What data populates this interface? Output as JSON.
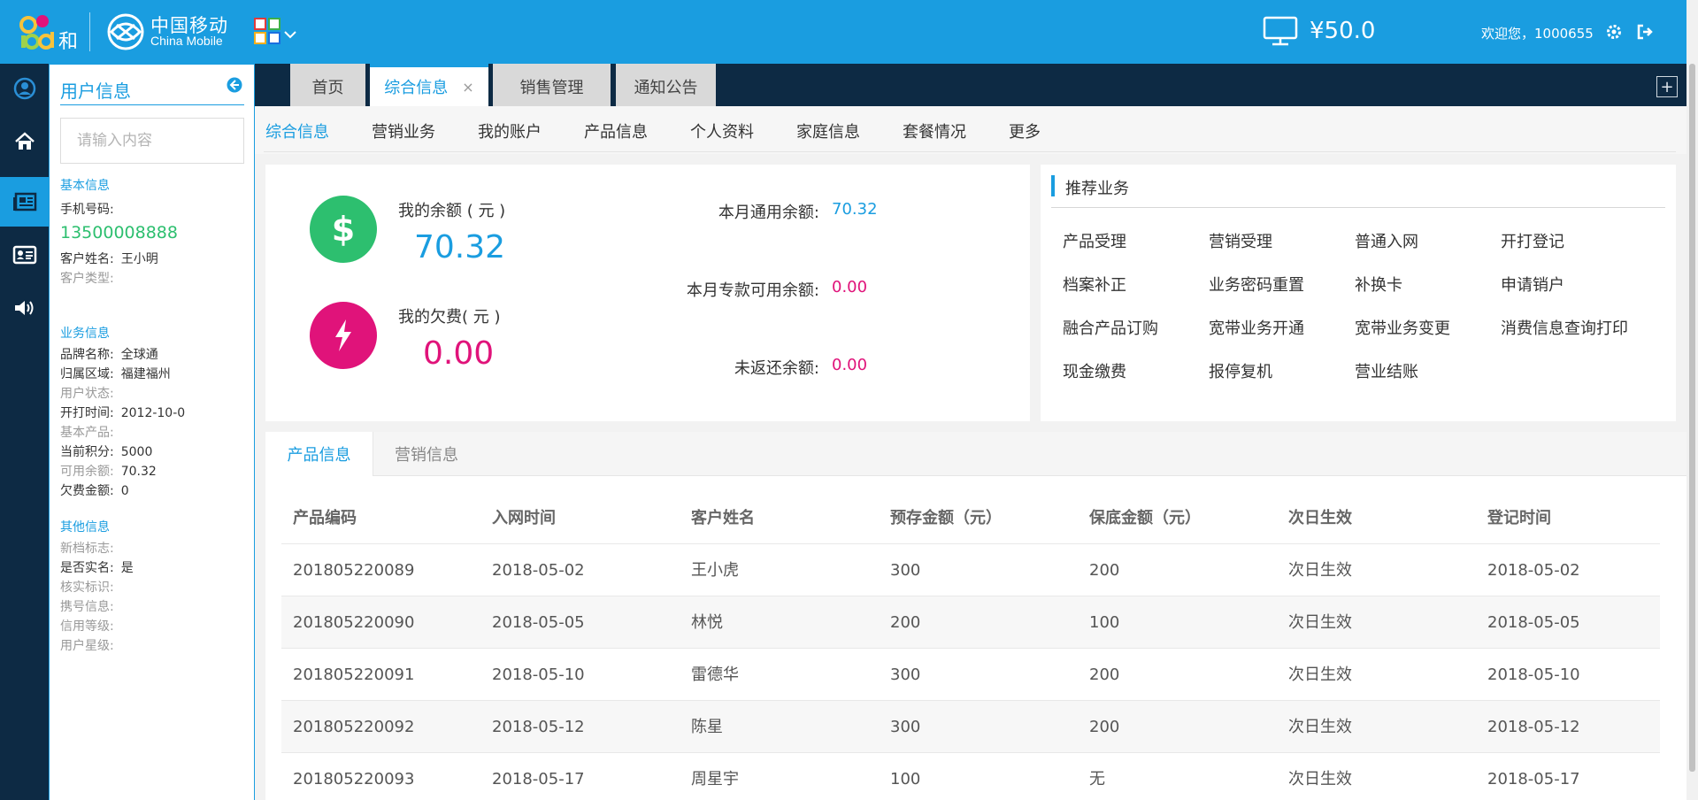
{
  "header": {
    "brand_cn": "中国移动",
    "brand_en": "China Mobile",
    "balance": "¥50.0",
    "welcome": "欢迎您，1000655"
  },
  "tabs": [
    {
      "label": "首页"
    },
    {
      "label": "综合信息",
      "close": "×"
    },
    {
      "label": "销售管理"
    },
    {
      "label": "通知公告"
    }
  ],
  "tab_add": "+",
  "user_panel": {
    "title": "用户信息",
    "search_placeholder": "请输入内容",
    "basic_title": "基本信息",
    "phone_label": "手机号码:",
    "phone": "13500008888",
    "name_label": "客户姓名:",
    "name": "王小明",
    "type_label": "客户类型:",
    "biz_title": "业务信息",
    "brand_label": "品牌名称:",
    "brand": "全球通",
    "region_label": "归属区域:",
    "region": "福建福州",
    "status_label": "用户状态:",
    "open_label": "开打时间:",
    "open": "2012-10-0",
    "product_label": "基本产品:",
    "points_label": "当前积分:",
    "points": "5000",
    "avail_label": "可用余额:",
    "avail": "70.32",
    "owe_label": "欠费金额:",
    "owe": "0",
    "other_title": "其他信息",
    "newflag_label": "新档标志:",
    "realname_label": "是否实名:",
    "realname": "是",
    "verify_label": "核实标识:",
    "port_label": "携号信息:",
    "credit_label": "信用等级:",
    "star_label": "用户星级:"
  },
  "subnav": [
    "综合信息",
    "营销业务",
    "我的账户",
    "产品信息",
    "个人资料",
    "家庭信息",
    "套餐情况",
    "更多"
  ],
  "balance_card": {
    "my_balance_label": "我的余额 ( 元 )",
    "my_balance": "70.32",
    "my_owe_label": "我的欠费( 元 )",
    "my_owe": "0.00",
    "general_label": "本月通用余额:",
    "general": "70.32",
    "special_label": "本月专款可用余额:",
    "special": "0.00",
    "unreturned_label": "未返还余额:",
    "unreturned": "0.00",
    "dollar": "$"
  },
  "recommend": {
    "title": "推荐业务",
    "items": [
      "产品受理",
      "营销受理",
      "普通入网",
      "开打登记",
      "档案补正",
      "业务密码重置",
      "补换卡",
      "申请销户",
      "融合产品订购",
      "宽带业务开通",
      "宽带业务变更",
      "消费信息查询打印",
      "现金缴费",
      "报停复机",
      "营业结账"
    ]
  },
  "product_tabs": [
    "产品信息",
    "营销信息"
  ],
  "table": {
    "columns": [
      "产品编码",
      "入网时间",
      "客户姓名",
      "预存金额（元）",
      "保底金额（元）",
      "次日生效",
      "登记时间"
    ],
    "rows": [
      [
        "201805220089",
        "2018-05-02",
        "王小虎",
        "300",
        "200",
        "次日生效",
        "2018-05-02"
      ],
      [
        "201805220090",
        "2018-05-05",
        "林悦",
        "200",
        "100",
        "次日生效",
        "2018-05-05"
      ],
      [
        "201805220091",
        "2018-05-10",
        "雷德华",
        "300",
        "200",
        "次日生效",
        "2018-05-10"
      ],
      [
        "201805220092",
        "2018-05-12",
        "陈星",
        "300",
        "200",
        "次日生效",
        "2018-05-12"
      ],
      [
        "201805220093",
        "2018-05-17",
        "周星宇",
        "100",
        "无",
        "次日生效",
        "2018-05-17"
      ]
    ]
  },
  "colors": {
    "accent": "#1a9de0",
    "nav": "#0d2a44",
    "green": "#2dbf6f",
    "pink": "#e0137a"
  }
}
